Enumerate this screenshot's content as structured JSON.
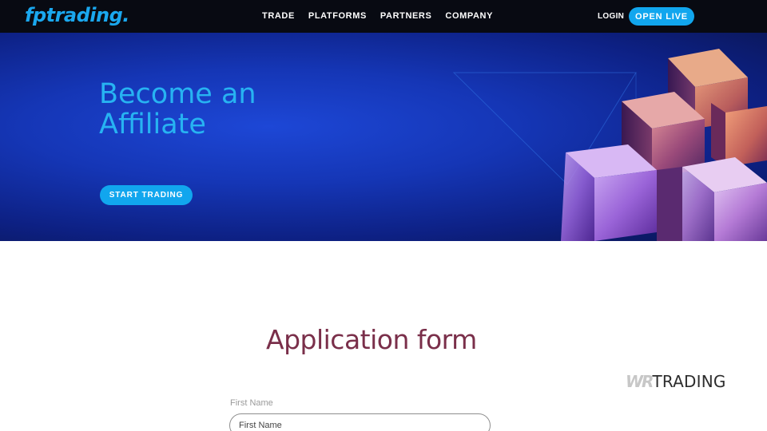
{
  "brand": {
    "logo_text": "fptrading",
    "logo_dot": ".",
    "color": "#1aa7ee"
  },
  "nav": {
    "items": [
      {
        "label": "TRADE"
      },
      {
        "label": "PLATFORMS"
      },
      {
        "label": "PARTNERS"
      },
      {
        "label": "COMPANY"
      }
    ],
    "login_label": "LOGIN",
    "open_live_label": "OPEN LIVE"
  },
  "hero": {
    "title_line1": "Become an",
    "title_line2": "Affiliate",
    "cta_label": "START TRADING",
    "art": "glowing-cubes-illustration"
  },
  "form": {
    "title": "Application form",
    "first_name_label": "First Name",
    "first_name_placeholder": "First Name",
    "first_name_value": ""
  },
  "watermark": {
    "mark": "WR",
    "text": "TRADING"
  },
  "colors": {
    "accent": "#11a6ee",
    "nav_bg": "#080a12",
    "hero_blue": "#1536b6",
    "form_title": "#7a2f4a"
  }
}
